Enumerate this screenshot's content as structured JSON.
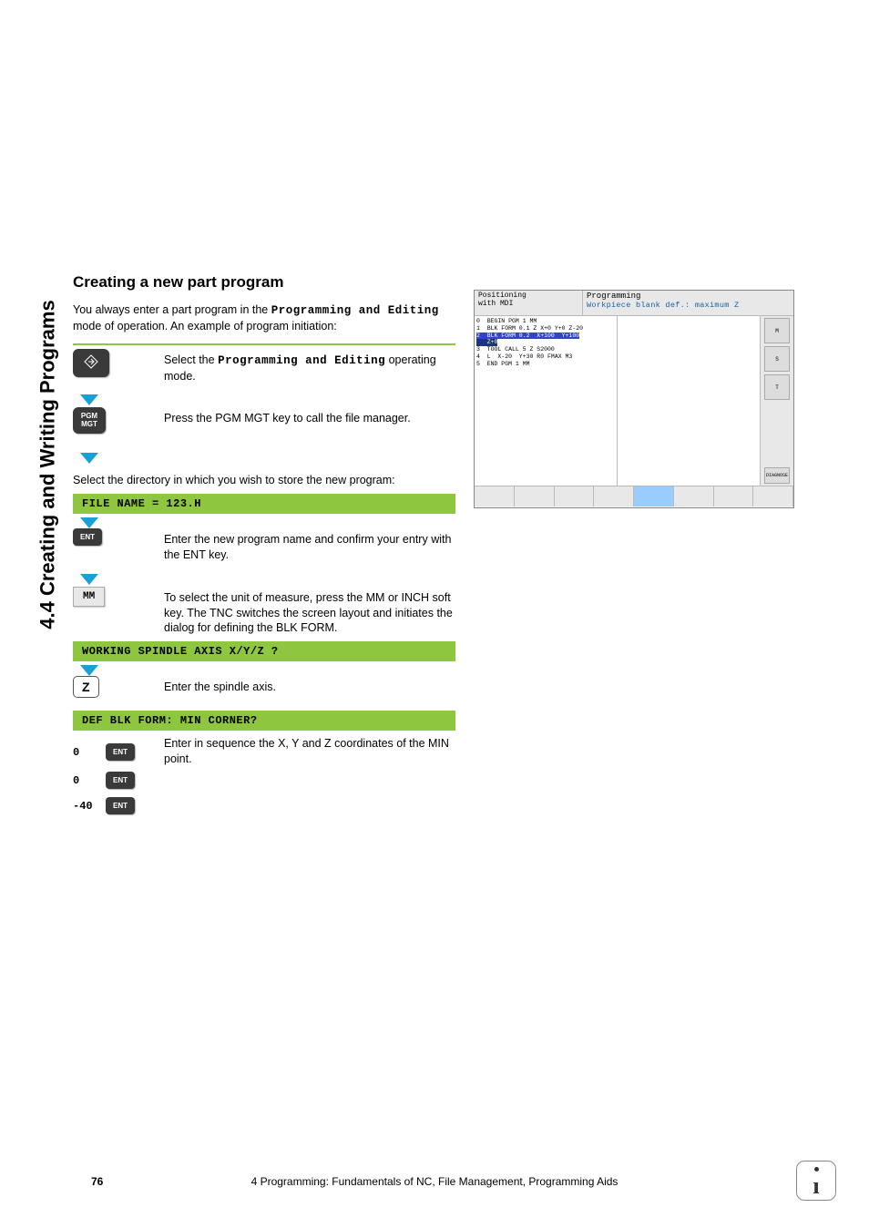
{
  "sideTab": "4.4 Creating and Writing Programs",
  "heading": "Creating a new part program",
  "intro_pre": "You always enter a part program in the ",
  "intro_mono": "Programming and Editing",
  "intro_post": " mode of operation. An example of program initiation:",
  "step1_pre": "Select the ",
  "step1_mono": "Programming and Editing",
  "step1_post": " operating mode.",
  "step2": "Press the PGM MGT key to call the file manager.",
  "select_dir": "Select the directory in which you wish to store the new program:",
  "prompt_filename": "FILE NAME = 123.H",
  "step3": "Enter the new program name and confirm your entry with the ENT key.",
  "step4": "To select the unit of measure, press the MM or INCH soft key. The TNC switches the screen layout and initiates the dialog for defining the BLK FORM.",
  "prompt_axis": "WORKING SPINDLE AXIS X/Y/Z ?",
  "step5": "Enter the spindle axis.",
  "prompt_min": "DEF BLK FORM: MIN CORNER?",
  "step6": "Enter in sequence the X, Y and Z coordinates of the MIN point.",
  "min_vals": [
    "0",
    "0",
    "-40"
  ],
  "keys": {
    "pgmmgt": "PGM\nMGT",
    "ent": "ENT",
    "mm": "MM",
    "z": "Z"
  },
  "screenshot": {
    "mode_left": "Positioning\nwith MDI",
    "mode_right": "Programming",
    "subtitle": "Workpiece blank def.: maximum Z",
    "code_plain_top": "0  BEGIN PGM 1 MM\n1  BLK FORM 0.1 Z X+0 Y+0 Z-20",
    "code_hl1": "2  BLK FORM 0.2  X+100  Y+100",
    "code_hl2": "   Z+0",
    "code_plain_bot": "3  TOOL CALL 5 Z S2000\n4  L  X-20  Y+30 R0 FMAX M3\n5  END PGM 1 MM",
    "side_labels": [
      "M",
      "S",
      "T"
    ],
    "diag": "DIAGNOSE"
  },
  "footer": {
    "page": "76",
    "chapter": "4 Programming: Fundamentals of NC, File Management, Programming Aids"
  }
}
